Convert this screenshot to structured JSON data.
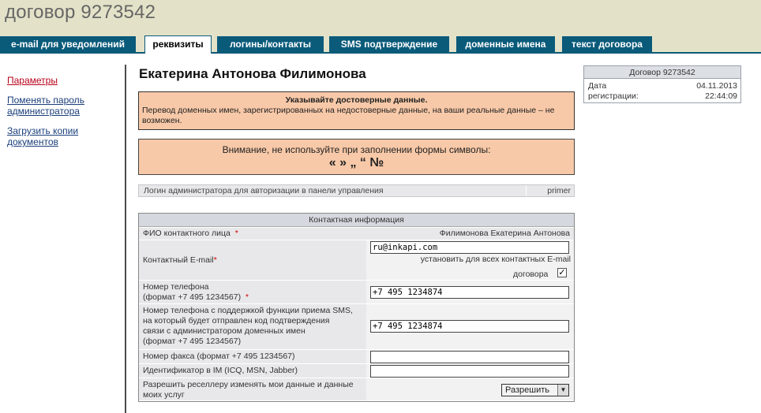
{
  "page_title": "договор 9273542",
  "tabs": [
    {
      "label": "e-mail для уведомлений"
    },
    {
      "label": "реквизиты"
    },
    {
      "label": "логины/контакты"
    },
    {
      "label": "SMS подтверждение"
    },
    {
      "label": "доменные имена"
    },
    {
      "label": "текст договора"
    }
  ],
  "sidebar": {
    "items": [
      {
        "label": "Параметры"
      },
      {
        "label": "Поменять пароль администратора"
      },
      {
        "label": "Загрузить копии документов"
      }
    ]
  },
  "main": {
    "person_name": "Екатерина Антонова Филимонова",
    "notice1": {
      "title": "Указывайте достоверные данные.",
      "body": "Перевод доменных имен, зарегистрированных на недостоверные данные, на ваши реальные данные – не возможен."
    },
    "notice2": {
      "text": "Внимание, не используйте при заполнении формы символы:",
      "symbols": "« » „ “ №"
    },
    "login_row": {
      "label": "Логин администратора для авторизации в панели управления",
      "value": "primer"
    },
    "contact": {
      "header": "Контактная информация",
      "fio_label": "ФИО контактного лица",
      "fio_value": "Филимонова Екатерина Антонова",
      "email_label": "Контактный E-mail",
      "email_value": "ru@inkapi.com",
      "email_all_line1": "установить для всех контактных E-mail",
      "email_all_line2": "договора",
      "phone_label_1": "Номер телефона",
      "phone_label_2": "(формат +7 495 1234567)",
      "phone_value": "+7 495 1234874",
      "sms_label_1": "Номер телефона с поддержкой функции приема SMS,",
      "sms_label_2": "на который будет отправлен код подтверждения",
      "sms_label_3": "связи с администратором доменных имен",
      "sms_label_4": "(формат +7 495 1234567)",
      "sms_value": "+7 495 1234874",
      "fax_label": "Номер факса (формат +7 495 1234567)",
      "fax_value": "",
      "im_label": "Идентификатор в IM (ICQ, MSN, Jabber)",
      "im_value": "",
      "reseller_label_1": "Разрешить реселлеру изменять мои данные и данные",
      "reseller_label_2": "моих услуг",
      "reseller_value": "Разрешить",
      "required_mark": "*"
    }
  },
  "infobox": {
    "header": "Договор 9273542",
    "date_label_1": "Дата",
    "date_label_2": "регистрации:",
    "date_value": "04.11.2013",
    "time_value": "22:44:09"
  },
  "colors": {
    "header_bg": "#e3e2c8",
    "tab_bg": "#0a5a7a",
    "notice_bg": "#f8c9a8",
    "link": "#1a3f7a",
    "link_active": "#b8001a"
  }
}
